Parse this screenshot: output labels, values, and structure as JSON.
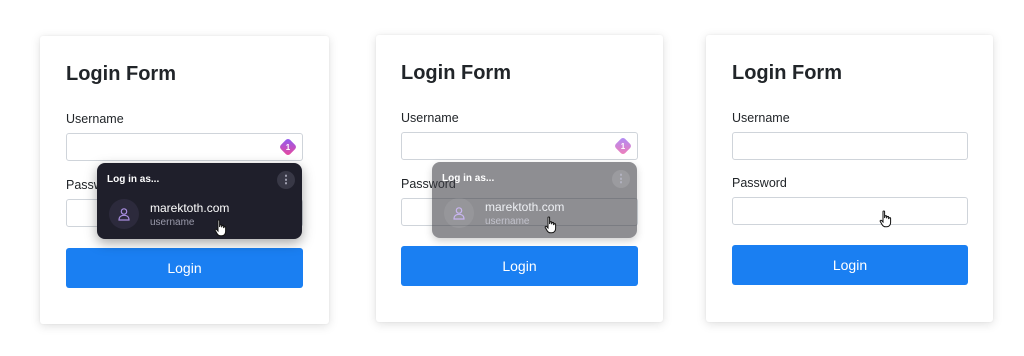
{
  "form": {
    "title": "Login Form",
    "username_label": "Username",
    "password_label": "Password",
    "login_label": "Login"
  },
  "popup": {
    "heading": "Log in as...",
    "menu_glyph": "⋮",
    "account": {
      "domain": "marektoth.com",
      "type": "username"
    }
  },
  "badge_count": "1",
  "colors": {
    "button": "#1a7ff2",
    "popup_bg": "#1f1f2b",
    "badge_gradient": [
      "#8b5cf6",
      "#ec4899"
    ]
  },
  "icons": [
    "password-manager-icon",
    "kebab-menu-icon",
    "user-icon",
    "hand-cursor-icon"
  ]
}
